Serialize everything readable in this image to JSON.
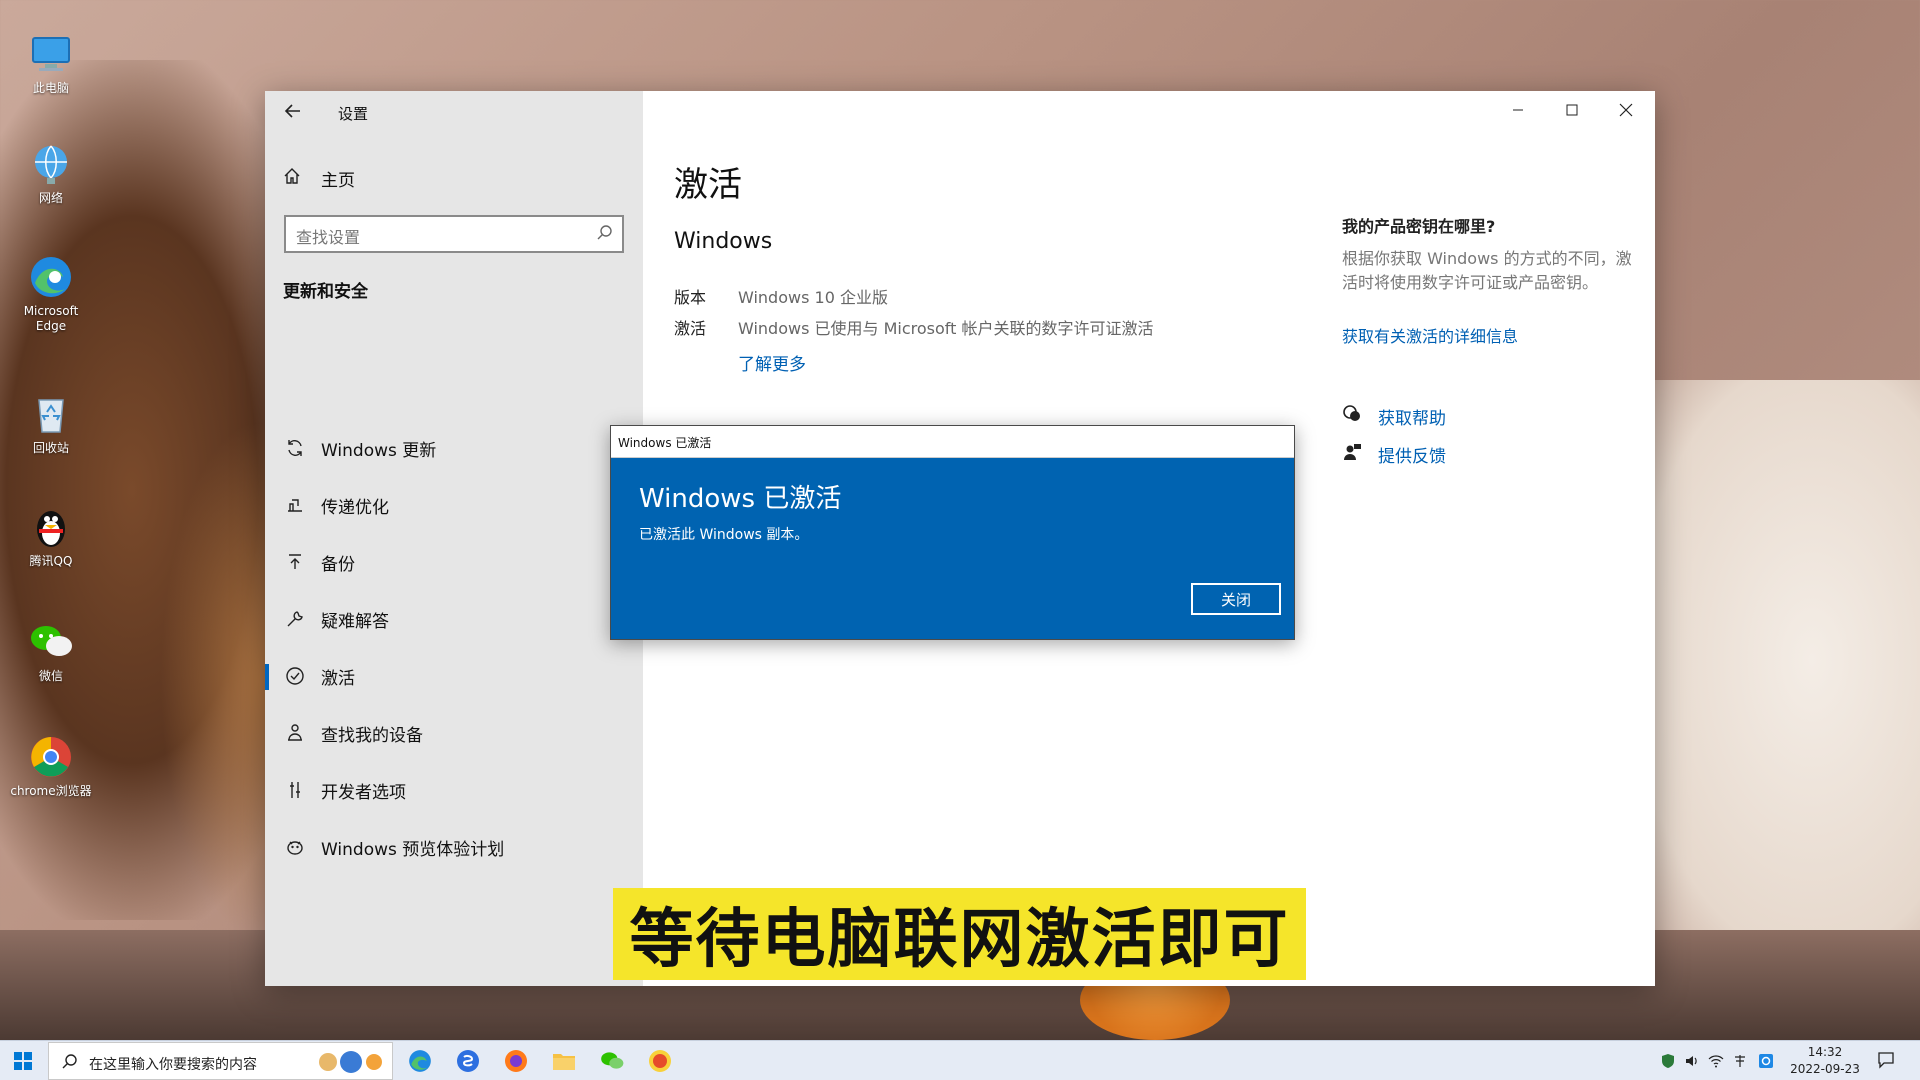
{
  "desktop": {
    "icons": [
      {
        "label": "此电脑"
      },
      {
        "label": "网络"
      },
      {
        "label": "Microsoft Edge"
      },
      {
        "label": "回收站"
      },
      {
        "label": "腾讯QQ"
      },
      {
        "label": "微信"
      },
      {
        "label": "chrome浏览器"
      }
    ]
  },
  "window": {
    "title": "设置",
    "controls": {
      "minimize_icon": "minimize-icon",
      "maximize_icon": "maximize-icon",
      "close_icon": "close-icon"
    }
  },
  "sidebar": {
    "home_label": "主页",
    "search_placeholder": "查找设置",
    "section_title": "更新和安全",
    "items": [
      {
        "label": "Windows 更新",
        "icon": "sync-icon"
      },
      {
        "label": "传递优化",
        "icon": "delivery-icon"
      },
      {
        "label": "备份",
        "icon": "backup-icon"
      },
      {
        "label": "疑难解答",
        "icon": "wrench-icon"
      },
      {
        "label": "激活",
        "icon": "check-circle-icon",
        "active": true
      },
      {
        "label": "查找我的设备",
        "icon": "person-location-icon"
      },
      {
        "label": "开发者选项",
        "icon": "developer-icon"
      },
      {
        "label": "Windows 预览体验计划",
        "icon": "insider-icon"
      }
    ]
  },
  "main": {
    "heading": "激活",
    "subheading": "Windows",
    "edition_label": "版本",
    "edition_value": "Windows 10 企业版",
    "activation_label": "激活",
    "activation_value": "Windows 已使用与 Microsoft 帐户关联的数字许可证激活",
    "learn_more": "了解更多"
  },
  "right_panel": {
    "title": "我的产品密钥在哪里?",
    "text": "根据你获取 Windows 的方式的不同，激活时将使用数字许可证或产品密钥。",
    "link": "获取有关激活的详细信息",
    "help": "获取帮助",
    "feedback": "提供反馈"
  },
  "dialog": {
    "bar_title": "Windows 已激活",
    "title": "Windows 已激活",
    "text": "已激活此 Windows 副本。",
    "close_button": "关闭"
  },
  "subtitle": "等待电脑联网激活即可",
  "taskbar": {
    "search_placeholder": "在这里输入你要搜索的内容",
    "time": "14:32",
    "date": "2022-09-23"
  },
  "colors": {
    "accent": "#0063b1",
    "link": "#0060b3",
    "banner": "#f5e52a"
  }
}
